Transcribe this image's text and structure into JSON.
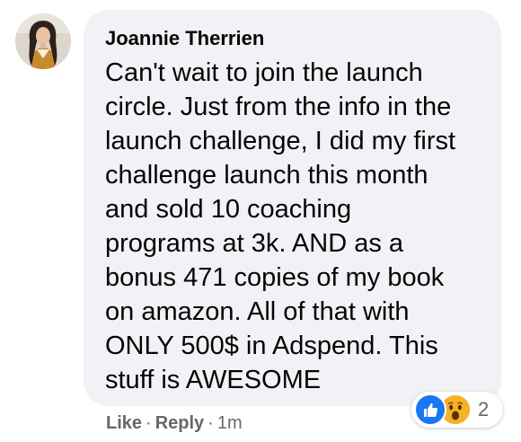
{
  "comment": {
    "author": "Joannie Therrien",
    "text_lines": [
      "Can't wait to join the launch",
      "circle. Just from the info in the",
      "launch challenge, I did my first",
      "challenge launch this month",
      "and sold 10 coaching",
      "programs at 3k. AND as a",
      "bonus 471 copies of my book",
      "on amazon. All of that with",
      "ONLY 500$ in Adspend. This",
      "stuff is AWESOME"
    ]
  },
  "reactions": {
    "types": [
      "like-icon",
      "wow-icon"
    ],
    "count": "2"
  },
  "actions": {
    "like_label": "Like",
    "separator": "·",
    "reply_label": "Reply",
    "timestamp": "1m"
  },
  "colors": {
    "bubble": "#f0f2f5",
    "text": "#050505",
    "secondary": "#65676b",
    "like_blue": "#1877f2",
    "wow_yellow": "#f7b125"
  }
}
